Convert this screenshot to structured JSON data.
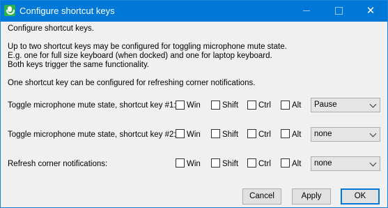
{
  "window": {
    "title": "Configure shortcut keys"
  },
  "content": {
    "heading": "Configure shortcut keys.",
    "desc_line1": "Up to two shortcut keys may be configured for toggling microphone mute state.",
    "desc_line2": "E.g. one for full size keyboard (when docked) and one for laptop keyboard.",
    "desc_line3": "Both keys trigger the same functionality.",
    "desc_line4": "One shortcut key can be configured for refreshing corner notifications."
  },
  "rows": [
    {
      "label": "Toggle microphone mute state, shortcut key #1:",
      "win": "Win",
      "shift": "Shift",
      "ctrl": "Ctrl",
      "alt": "Alt",
      "win_checked": false,
      "shift_checked": false,
      "ctrl_checked": false,
      "alt_checked": false,
      "key": "Pause"
    },
    {
      "label": "Toggle microphone mute state, shortcut key #2:",
      "win": "Win",
      "shift": "Shift",
      "ctrl": "Ctrl",
      "alt": "Alt",
      "win_checked": false,
      "shift_checked": false,
      "ctrl_checked": false,
      "alt_checked": false,
      "key": "none"
    },
    {
      "label": "Refresh corner notifications:",
      "win": "Win",
      "shift": "Shift",
      "ctrl": "Ctrl",
      "alt": "Alt",
      "win_checked": false,
      "shift_checked": false,
      "ctrl_checked": false,
      "alt_checked": false,
      "key": "none"
    }
  ],
  "buttons": {
    "cancel": "Cancel",
    "apply": "Apply",
    "ok": "OK"
  },
  "icons": {
    "app": "microphone-icon",
    "minimize": "minimize-icon",
    "maximize": "maximize-icon",
    "close": "close-icon"
  },
  "colors": {
    "titlebar": "#0078d7",
    "app_icon": "#2db34a",
    "default_button_border": "#0078d7"
  }
}
